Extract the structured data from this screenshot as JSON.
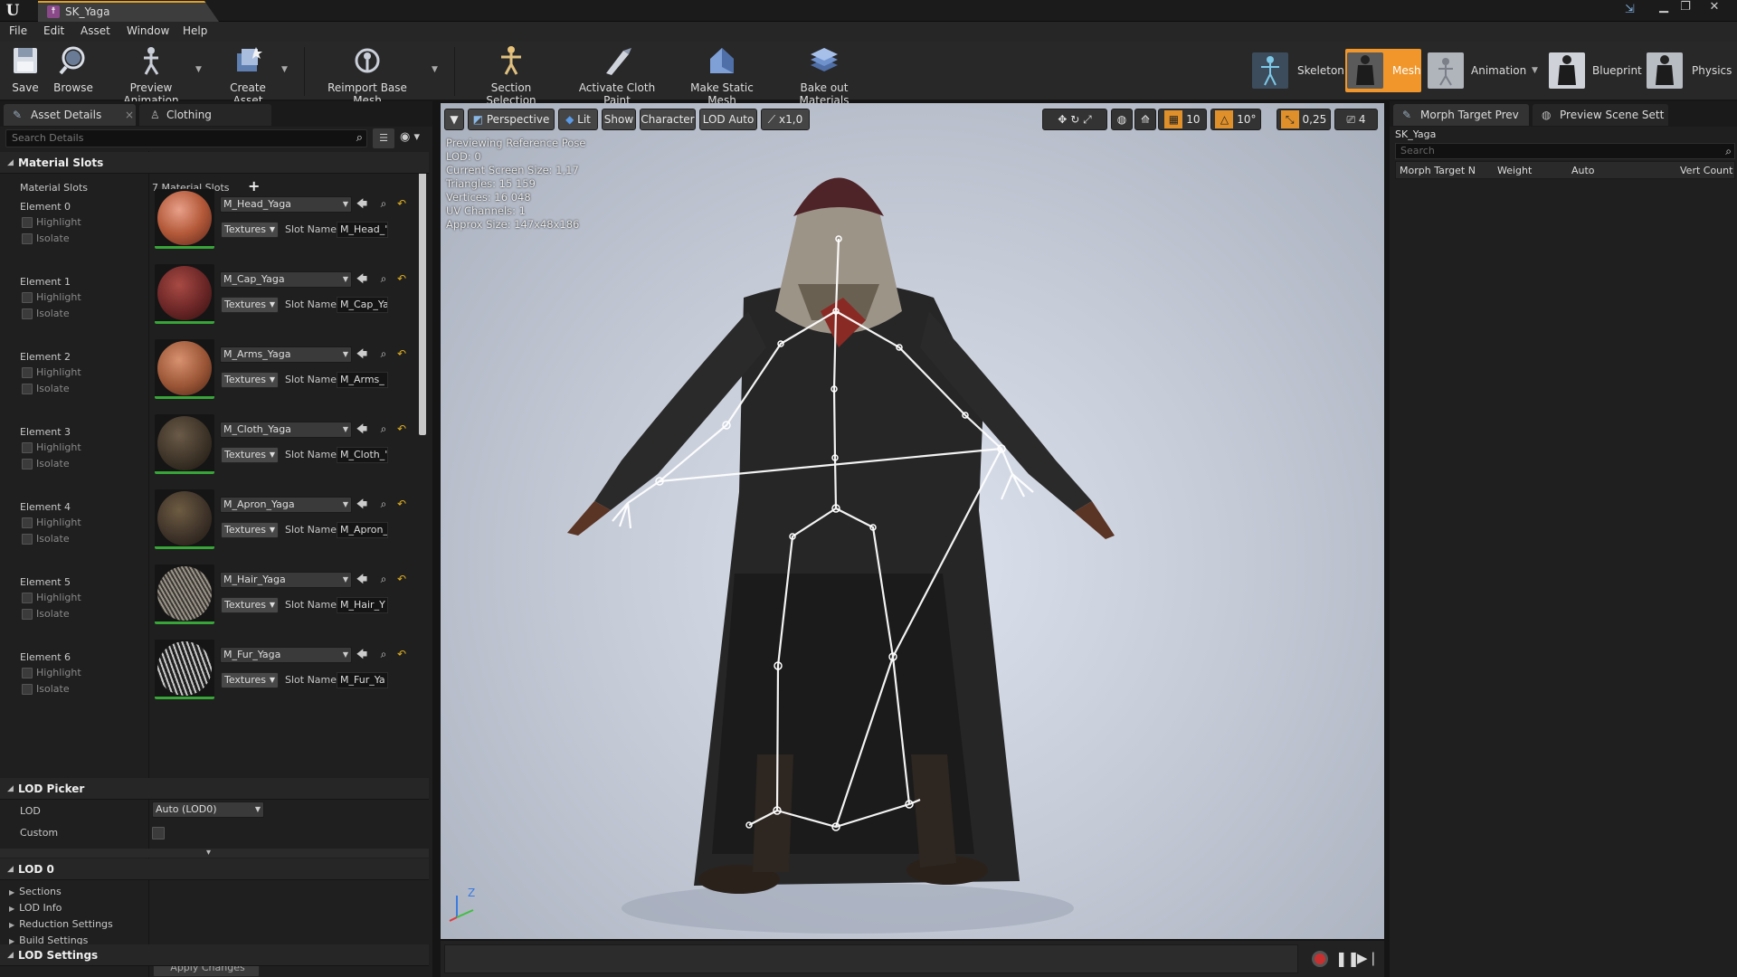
{
  "window": {
    "tab_title": "SK_Yaga",
    "logo": "U"
  },
  "menu": [
    "File",
    "Edit",
    "Asset",
    "Window",
    "Help"
  ],
  "toolbar": {
    "left": [
      {
        "label": "Save",
        "icon": "save-icon"
      },
      {
        "label": "Browse",
        "icon": "browse-icon"
      },
      {
        "label": "Preview Animation",
        "icon": "preview-animation-icon"
      },
      {
        "label": "Create Asset",
        "icon": "create-asset-icon"
      },
      {
        "label": "Reimport Base Mesh",
        "icon": "reimport-icon"
      },
      {
        "label": "Section Selection",
        "icon": "section-selection-icon"
      },
      {
        "label": "Activate Cloth Paint",
        "icon": "cloth-paint-icon"
      },
      {
        "label": "Make Static Mesh",
        "icon": "static-mesh-icon"
      },
      {
        "label": "Bake out Materials",
        "icon": "bake-materials-icon"
      }
    ],
    "modes": [
      {
        "label": "Skeleton",
        "active": false
      },
      {
        "label": "Mesh",
        "active": true
      },
      {
        "label": "Animation",
        "active": false
      },
      {
        "label": "Blueprint",
        "active": false
      },
      {
        "label": "Physics",
        "active": false
      }
    ]
  },
  "left_panel": {
    "tabs": [
      "Asset Details",
      "Clothing"
    ],
    "search_placeholder": "Search Details",
    "material_slots": {
      "section": "Material Slots",
      "label": "Material Slots",
      "count_text": "7 Material Slots",
      "highlight_label": "Highlight",
      "isolate_label": "Isolate",
      "textures_label": "Textures",
      "slot_name_label": "Slot Name",
      "elements": [
        {
          "name": "Element 0",
          "material": "M_Head_Yaga",
          "slot": "M_Head_'"
        },
        {
          "name": "Element 1",
          "material": "M_Cap_Yaga",
          "slot": "M_Cap_Ya"
        },
        {
          "name": "Element 2",
          "material": "M_Arms_Yaga",
          "slot": "M_Arms_"
        },
        {
          "name": "Element 3",
          "material": "M_Cloth_Yaga",
          "slot": "M_Cloth_'"
        },
        {
          "name": "Element 4",
          "material": "M_Apron_Yaga",
          "slot": "M_Apron_"
        },
        {
          "name": "Element 5",
          "material": "M_Hair_Yaga",
          "slot": "M_Hair_Y"
        },
        {
          "name": "Element 6",
          "material": "M_Fur_Yaga",
          "slot": "M_Fur_Ya"
        }
      ]
    },
    "lod_picker": {
      "section": "LOD Picker",
      "lod_label": "LOD",
      "lod_value": "Auto (LOD0)",
      "custom_label": "Custom"
    },
    "lod0": {
      "section": "LOD 0",
      "items": [
        "Sections",
        "LOD Info",
        "Reduction Settings",
        "Build Settings"
      ],
      "apply": "Apply Changes"
    },
    "lod_settings": {
      "section": "LOD Settings"
    }
  },
  "viewport": {
    "toolbar": {
      "perspective": "Perspective",
      "lit": "Lit",
      "show": "Show",
      "character": "Character",
      "lod": "LOD Auto",
      "speed": "x1,0",
      "grid_snap": "10",
      "rot_snap": "10°",
      "scale_snap": "0,25",
      "cam_speed": "4"
    },
    "stats": [
      "Previewing Reference Pose",
      "LOD: 0",
      "Current Screen Size: 1,17",
      "Triangles: 15 159",
      "Vertices: 16 048",
      "UV Channels: 1",
      "Approx Size: 147x48x186"
    ],
    "axis_z": "Z"
  },
  "right_panel": {
    "tabs": [
      "Morph Target Prev",
      "Preview Scene Sett"
    ],
    "asset": "SK_Yaga",
    "search_placeholder": "Search",
    "columns": [
      "Morph Target N",
      "Weight",
      "Auto",
      "Vert Count"
    ]
  },
  "colors": {
    "accent_orange": "#e0a020",
    "active_mode": "#f0962a",
    "green_underline": "#37a537"
  }
}
